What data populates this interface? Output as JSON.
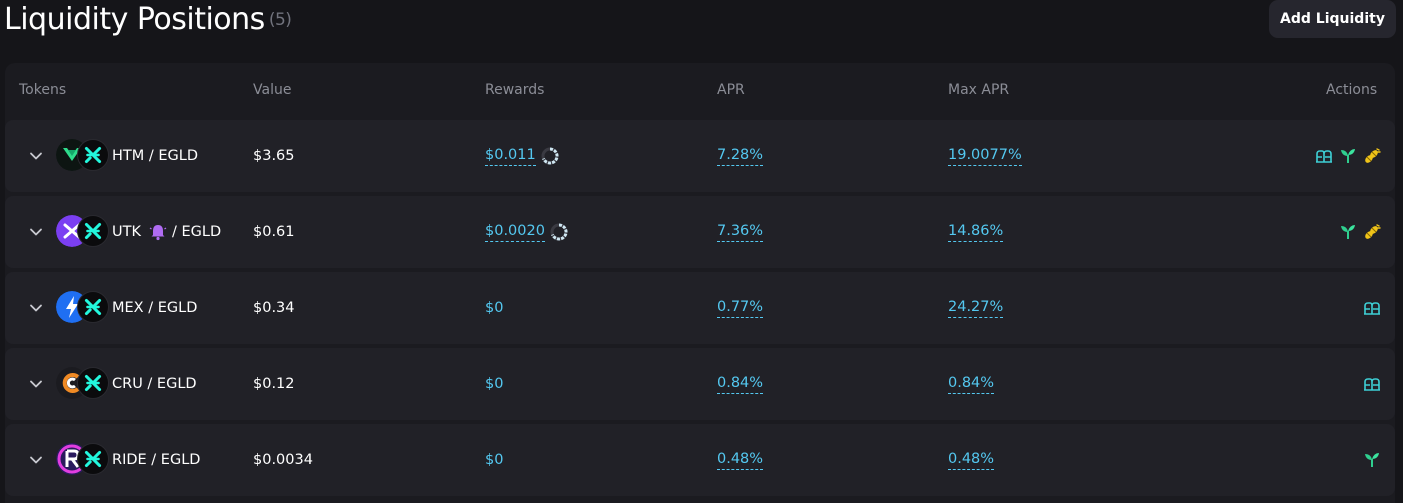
{
  "header": {
    "title": "Liquidity Positions",
    "count": "(5)",
    "add_button_label": "Add Liquidity"
  },
  "columns": {
    "tokens": "Tokens",
    "value": "Value",
    "rewards": "Rewards",
    "apr": "APR",
    "max_apr": "Max APR",
    "actions": "Actions"
  },
  "colors": {
    "accent": "#54c8f0",
    "background": "#151519",
    "panel": "#1b1b20",
    "row": "#212127"
  },
  "rows": [
    {
      "token_a": "HTM",
      "separator": "/",
      "token_b": "EGLD",
      "value": "$3.65",
      "rewards": "$0.011",
      "apr": "7.28%",
      "max_apr": "19.0077%",
      "token_a_icon": "htm-token-icon",
      "token_b_icon": "egld-token-icon",
      "actions": [
        "farm-icon",
        "stake-sprout-icon",
        "boost-icon"
      ]
    },
    {
      "token_a": "UTK",
      "separator": "/",
      "token_b": "EGLD",
      "value": "$0.61",
      "rewards": "$0.0020",
      "apr": "7.36%",
      "max_apr": "14.86%",
      "token_a_icon": "utk-token-icon",
      "token_b_icon": "egld-token-icon",
      "actions": [
        "stake-sprout-icon",
        "boost-icon"
      ]
    },
    {
      "token_a": "MEX",
      "separator": "/",
      "token_b": "EGLD",
      "value": "$0.34",
      "rewards": "$0",
      "apr": "0.77%",
      "max_apr": "24.27%",
      "token_a_icon": "mex-token-icon",
      "token_b_icon": "egld-token-icon",
      "actions": [
        "farm-icon"
      ]
    },
    {
      "token_a": "CRU",
      "separator": "/",
      "token_b": "EGLD",
      "value": "$0.12",
      "rewards": "$0",
      "apr": "0.84%",
      "max_apr": "0.84%",
      "token_a_icon": "cru-token-icon",
      "token_b_icon": "egld-token-icon",
      "actions": [
        "farm-icon"
      ]
    },
    {
      "token_a": "RIDE",
      "separator": "/",
      "token_b": "EGLD",
      "value": "$0.0034",
      "rewards": "$0",
      "apr": "0.48%",
      "max_apr": "0.48%",
      "token_a_icon": "ride-token-icon",
      "token_b_icon": "egld-token-icon",
      "actions": [
        "stake-sprout-icon"
      ]
    }
  ]
}
